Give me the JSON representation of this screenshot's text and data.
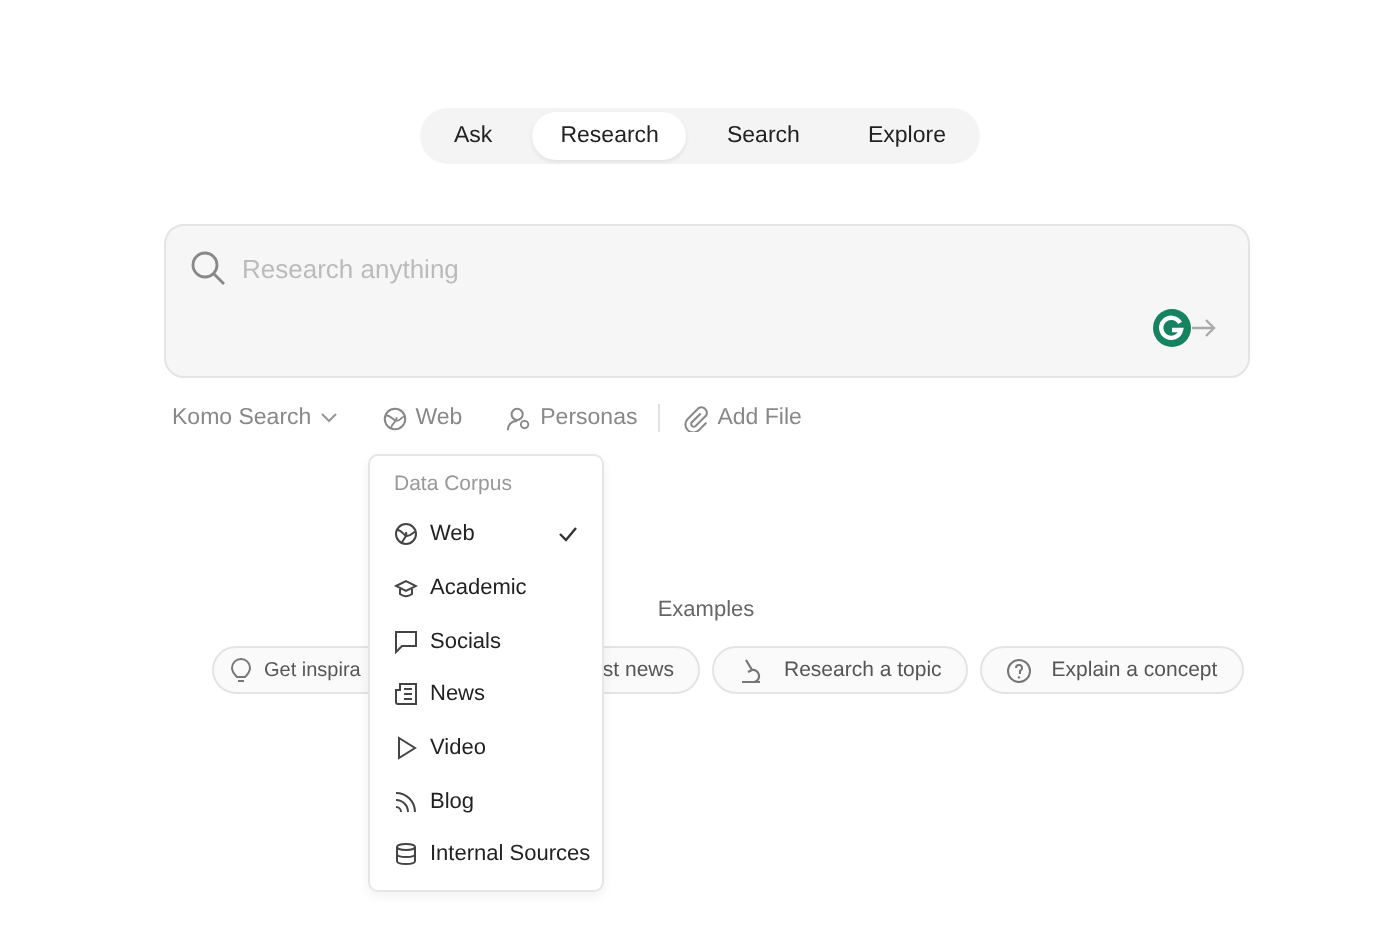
{
  "tabs": [
    {
      "label": "Ask",
      "selected": false
    },
    {
      "label": "Research",
      "selected": true
    },
    {
      "label": "Search",
      "selected": false
    },
    {
      "label": "Explore",
      "selected": false
    }
  ],
  "search": {
    "placeholder": "Research anything"
  },
  "toolbar": {
    "engine": "Komo Search",
    "source": "Web",
    "personas": "Personas",
    "add_file": "Add File"
  },
  "dropdown": {
    "heading": "Data Corpus",
    "items": [
      {
        "label": "Web",
        "selected": true
      },
      {
        "label": "Academic",
        "selected": false
      },
      {
        "label": "Socials",
        "selected": false
      },
      {
        "label": "News",
        "selected": false
      },
      {
        "label": "Video",
        "selected": false
      },
      {
        "label": "Blog",
        "selected": false
      },
      {
        "label": "Internal Sources",
        "selected": false
      }
    ]
  },
  "examples": {
    "heading": "Examples",
    "chips": [
      {
        "label": "Get inspira"
      },
      {
        "label": "st news"
      },
      {
        "label": "Research a topic"
      },
      {
        "label": "Explain a concept"
      }
    ]
  }
}
